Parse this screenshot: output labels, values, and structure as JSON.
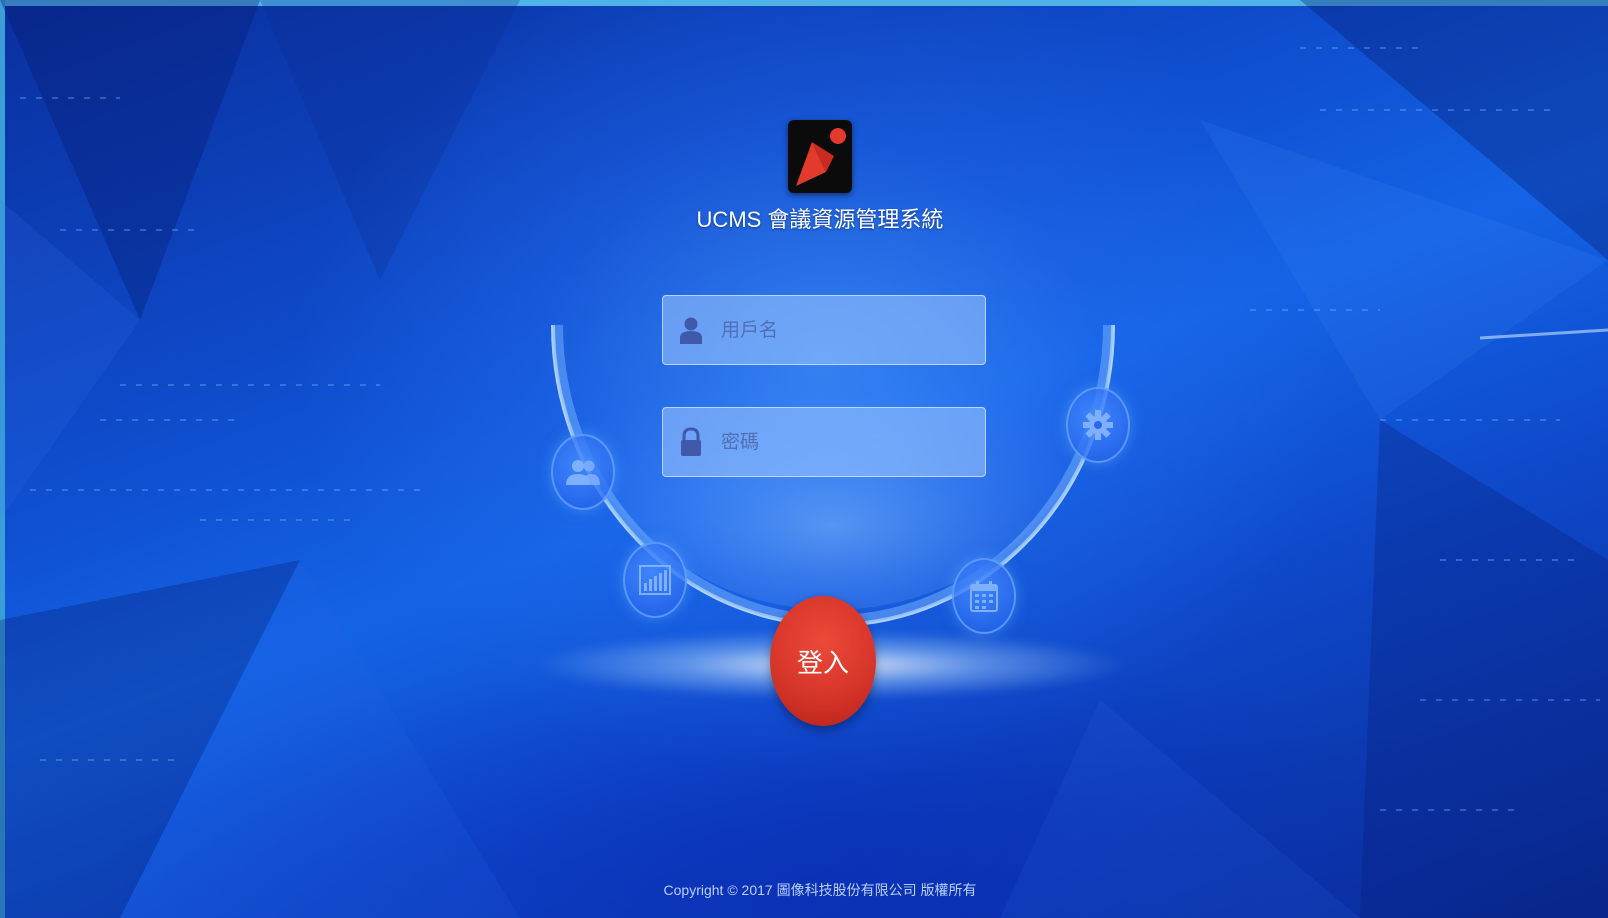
{
  "app": {
    "title": "UCMS 會議資源管理系統"
  },
  "login_form": {
    "username_placeholder": "用戶名",
    "password_placeholder": "密碼",
    "submit_label": "登入"
  },
  "feature_bubbles": [
    {
      "icon": "users-icon"
    },
    {
      "icon": "bar-chart-icon"
    },
    {
      "icon": "calendar-icon"
    },
    {
      "icon": "gear-icon"
    }
  ],
  "footer": {
    "copyright": "Copyright © 2017 圖像科技股份有限公司 版權所有"
  },
  "colors": {
    "background_primary": "#1463e6",
    "background_dark": "#0a2a95",
    "button_red": "#d6352a",
    "logo_bg": "#0b0b0b",
    "border_accent": "#4fb3e8"
  }
}
